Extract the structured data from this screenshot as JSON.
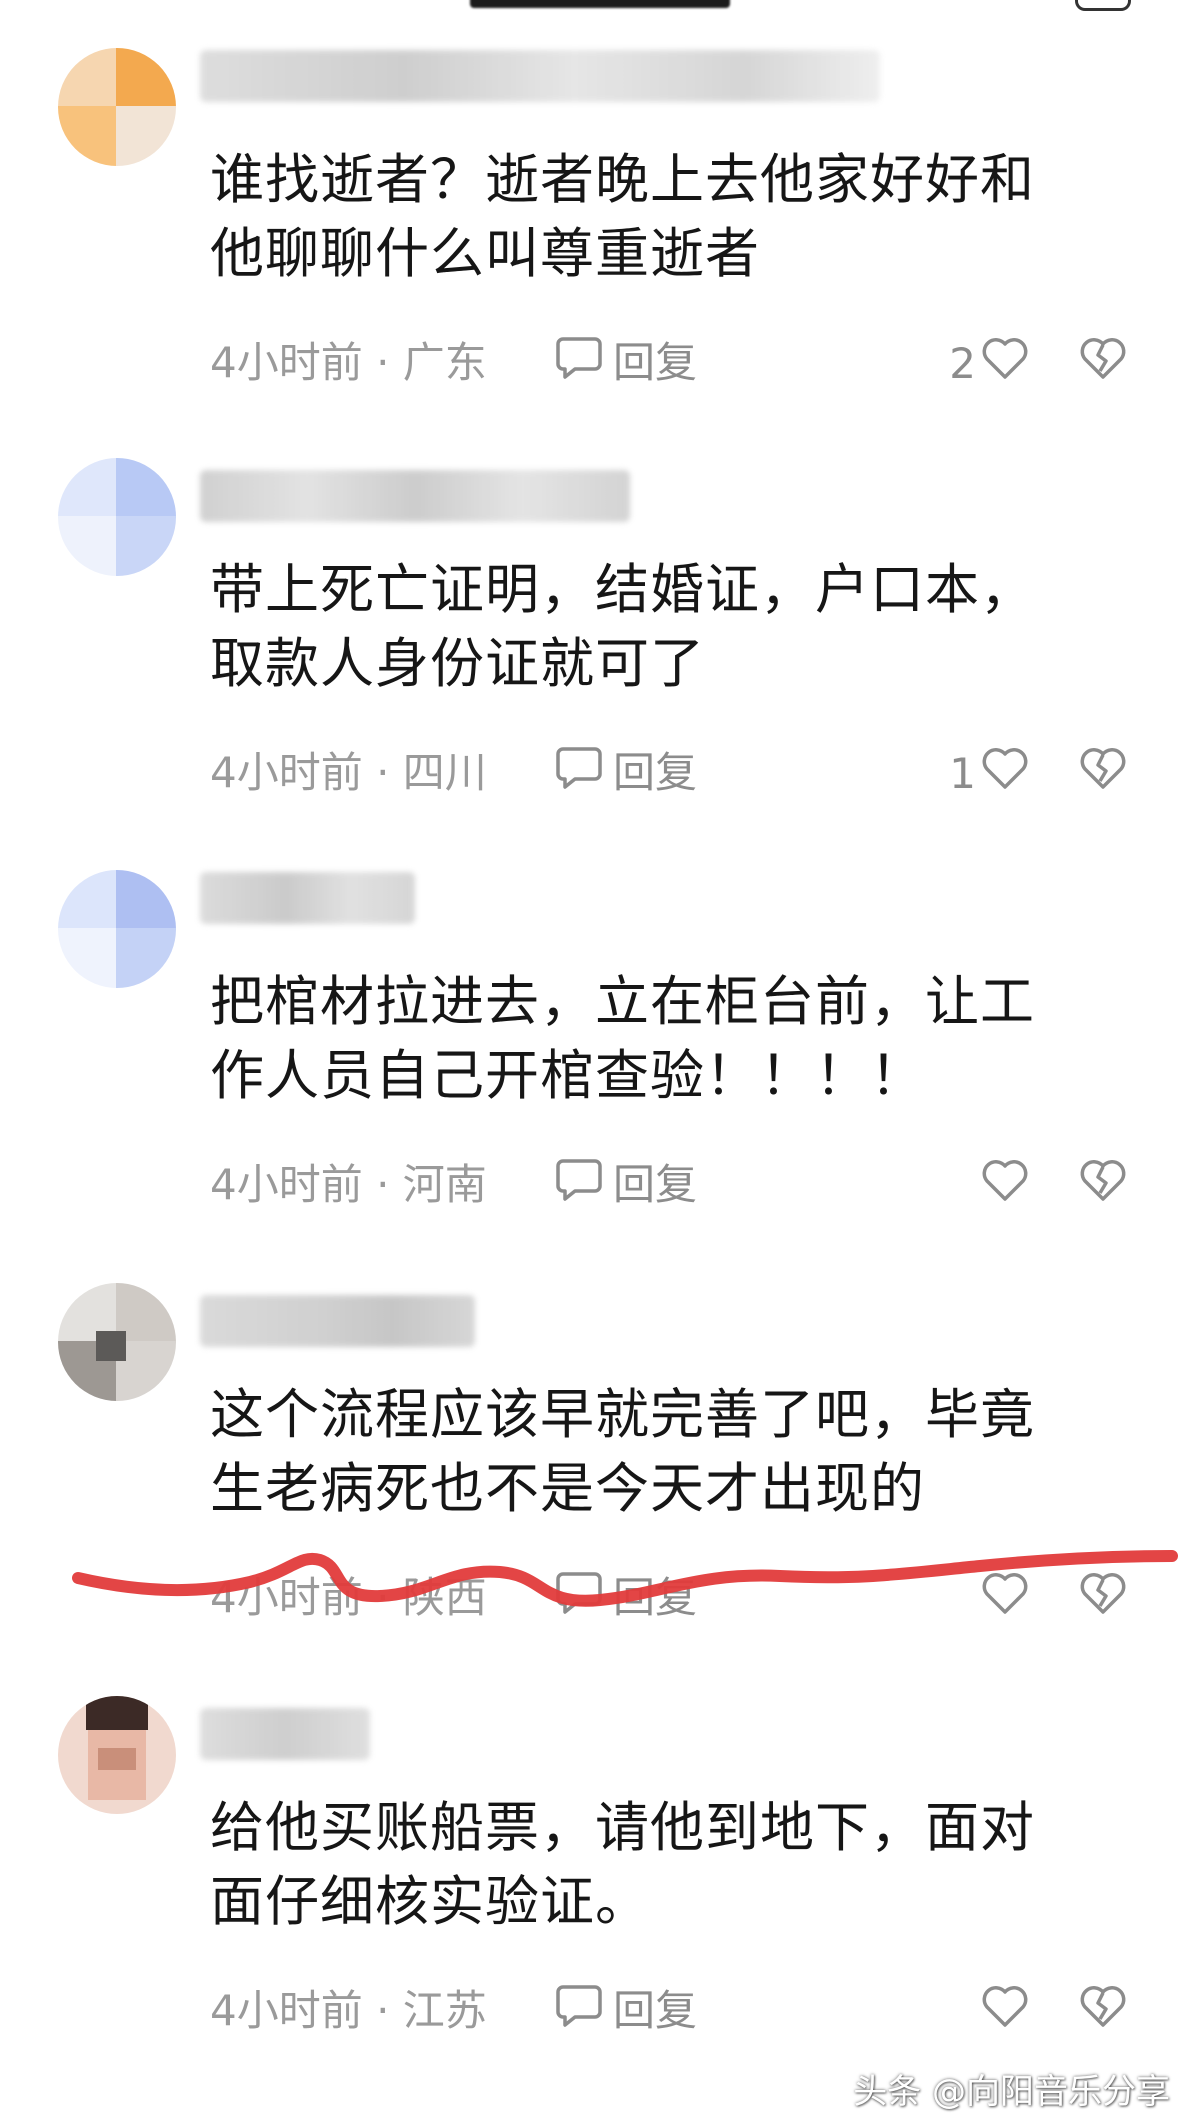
{
  "top_fragment": {},
  "comments": [
    {
      "text_line1": "谁找逝者？逝者晚上去他家好好和",
      "text_line2": "他聊聊什么叫尊重逝者",
      "time": "4小时前",
      "location": "广东",
      "reply_label": "回复",
      "like_count": "2",
      "avatar_colors": [
        "#f6d6b0",
        "#f3a94f",
        "#f8c27c",
        "#f2e4d6"
      ]
    },
    {
      "text_line1": "带上死亡证明，结婚证，户口本，",
      "text_line2": "取款人身份证就可了",
      "time": "4小时前",
      "location": "四川",
      "reply_label": "回复",
      "like_count": "1",
      "avatar_colors": [
        "#dfe7fb",
        "#b8c9f5",
        "#eef2fc",
        "#c9d6f7"
      ]
    },
    {
      "text_line1": "把棺材拉进去，立在柜台前，让工",
      "text_line2": "作人员自己开棺查验！！！！",
      "time": "4小时前",
      "location": "河南",
      "reply_label": "回复",
      "like_count": "",
      "avatar_colors": [
        "#dce5fb",
        "#aebff2",
        "#eff3fd",
        "#c4d2f6"
      ]
    },
    {
      "text_line1": "这个流程应该早就完善了吧，毕竟",
      "text_line2": "生老病死也不是今天才出现的",
      "time": "4小时前",
      "location": "陕西",
      "reply_label": "回复",
      "like_count": "",
      "avatar_colors": [
        "#e3e1de",
        "#9d9893",
        "#cfcac5",
        "#5c5a58"
      ]
    },
    {
      "text_line1": "给他买账船票，请他到地下，面对",
      "text_line2": "面仔细核实验证。",
      "time": "4小时前",
      "location": "江苏",
      "reply_label": "回复",
      "like_count": "",
      "avatar_colors": [
        "#f1d9cf",
        "#e8b8a6",
        "#3c2a26",
        "#c98f7a"
      ]
    }
  ],
  "watermark": "头条 @向阳音乐分享",
  "colors": {
    "meta_gray": "#9a9a9a",
    "annotation_red": "#e23b3b",
    "text_dark": "#161616"
  },
  "icons": {
    "reply": "speech-bubble-icon",
    "like": "heart-outline-icon",
    "dislike": "broken-heart-icon"
  }
}
